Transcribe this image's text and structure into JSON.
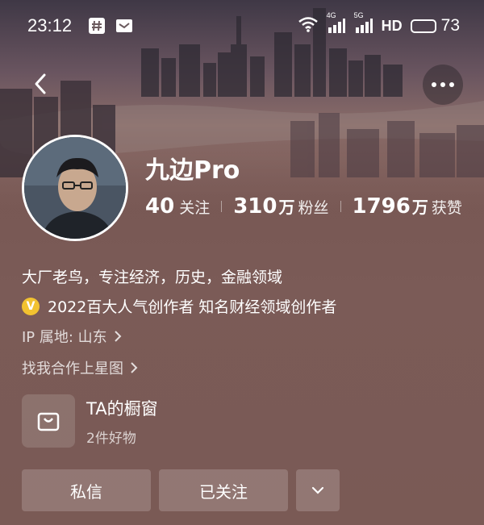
{
  "status_bar": {
    "time": "23:12",
    "network_1": "4G",
    "network_2": "5G",
    "hd": "HD",
    "battery": "73",
    "battery_level": 0.73
  },
  "profile": {
    "name": "九边Pro",
    "stats": [
      {
        "num": "40",
        "unit": "",
        "label": "关注"
      },
      {
        "num": "310",
        "unit": "万",
        "label": "粉丝"
      },
      {
        "num": "1796",
        "unit": "万",
        "label": "获赞"
      }
    ],
    "bio": "大厂老鸟，专注经济，历史，金融领域",
    "badge_mark": "V",
    "badge_text": "2022百大人气创作者 知名财经领域创作者",
    "ip": "IP 属地: 山东",
    "star_link": "找我合作上星图"
  },
  "shop": {
    "title": "TA的橱窗",
    "subtitle": "2件好物"
  },
  "actions": {
    "message": "私信",
    "followed": "已关注"
  },
  "icons": {
    "back": "chevron-left-icon",
    "more": "more-dots-icon",
    "shop": "shopping-bag-icon",
    "dropdown": "chevron-down-icon"
  }
}
